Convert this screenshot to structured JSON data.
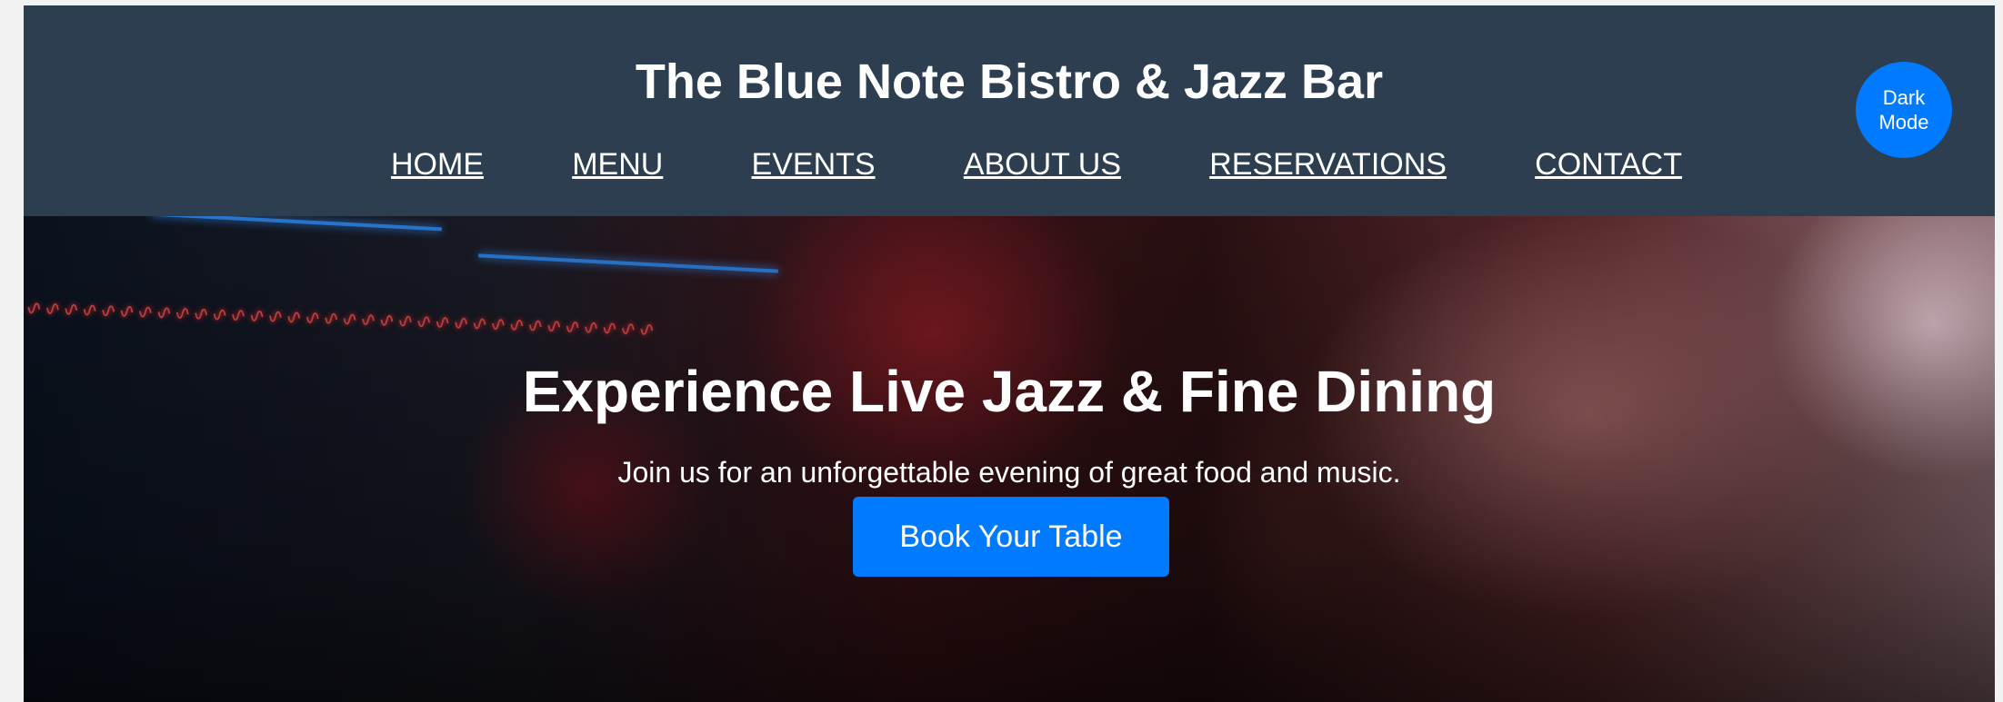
{
  "header": {
    "title": "The Blue Note Bistro & Jazz Bar",
    "theme_toggle_label": "Dark\nMode",
    "nav": [
      {
        "label": "HOME"
      },
      {
        "label": "MENU"
      },
      {
        "label": "EVENTS"
      },
      {
        "label": "ABOUT US"
      },
      {
        "label": "RESERVATIONS"
      },
      {
        "label": "CONTACT"
      }
    ]
  },
  "hero": {
    "title": "Experience Live Jazz & Fine Dining",
    "subtitle": "Join us for an unforgettable evening of great food and music.",
    "cta_label": "Book Your Table"
  },
  "colors": {
    "header_bg": "#2c3e50",
    "accent": "#007bff",
    "text": "#ffffff"
  }
}
